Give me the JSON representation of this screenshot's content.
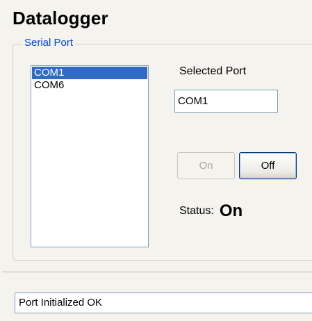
{
  "window": {
    "title": "Datalogger"
  },
  "serial_port": {
    "group_label": "Serial Port",
    "ports": [
      {
        "label": "COM1",
        "selected": true
      },
      {
        "label": "COM6",
        "selected": false
      }
    ],
    "selected_port_label": "Selected Port",
    "selected_port_value": "COM1",
    "on_button_label": "On",
    "on_button_enabled": false,
    "off_button_label": "Off",
    "off_button_enabled": true,
    "status_label": "Status:",
    "status_value": "On"
  },
  "status_bar": {
    "message": "Port Initialized OK"
  },
  "colors": {
    "window_background": "#f4f3ee",
    "group_label": "#0046d5",
    "list_selection": "#316ac5",
    "field_border": "#7f9db9",
    "disabled_text": "#aca899"
  }
}
